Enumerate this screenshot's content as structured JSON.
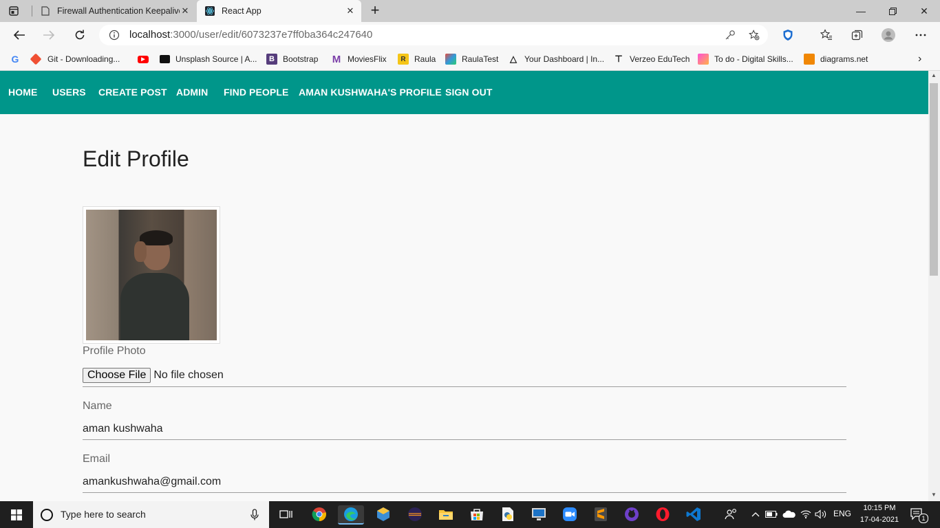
{
  "browser": {
    "tabs": [
      {
        "title": "Firewall Authentication Keepalive",
        "active": false
      },
      {
        "title": "React App",
        "active": true
      }
    ],
    "address": {
      "host": "localhost",
      "rest": ":3000/user/edit/6073237e7ff0ba364c247640"
    },
    "bookmarks": [
      {
        "label": "",
        "icon": "google-icon"
      },
      {
        "label": "Git - Downloading...",
        "icon": "git-icon"
      },
      {
        "label": "",
        "icon": "youtube-icon"
      },
      {
        "label": "Unsplash Source | A...",
        "icon": "unsplash-icon"
      },
      {
        "label": "Bootstrap",
        "icon": "bootstrap-icon"
      },
      {
        "label": "MoviesFlix",
        "icon": "moviesflix-icon"
      },
      {
        "label": "Raula",
        "icon": "raula-icon"
      },
      {
        "label": "RaulaTest",
        "icon": "raulatest-icon"
      },
      {
        "label": "Your Dashboard | In...",
        "icon": "dashboard-icon"
      },
      {
        "label": "Verzeo EduTech",
        "icon": "verzeo-icon"
      },
      {
        "label": "To do - Digital Skills...",
        "icon": "todo-icon"
      },
      {
        "label": "diagrams.net",
        "icon": "diagrams-icon"
      }
    ]
  },
  "nav": {
    "items": [
      "HOME",
      "USERS",
      "CREATE POST",
      "ADMIN",
      "FIND PEOPLE",
      "AMAN KUSHWAHA'S PROFILE",
      "SIGN OUT"
    ]
  },
  "form": {
    "title": "Edit Profile",
    "photo_label": "Profile Photo",
    "file_button": "Choose File",
    "file_status": "No file chosen",
    "name_label": "Name",
    "name_value": "aman kushwaha",
    "email_label": "Email",
    "email_value": "amankushwaha@gmail.com"
  },
  "taskbar": {
    "search_placeholder": "Type here to search",
    "language": "ENG",
    "time": "10:15 PM",
    "date": "17-04-2021",
    "notification_count": "1"
  },
  "colors": {
    "navbar": "#00968a",
    "taskbar": "#1f1f1f"
  }
}
